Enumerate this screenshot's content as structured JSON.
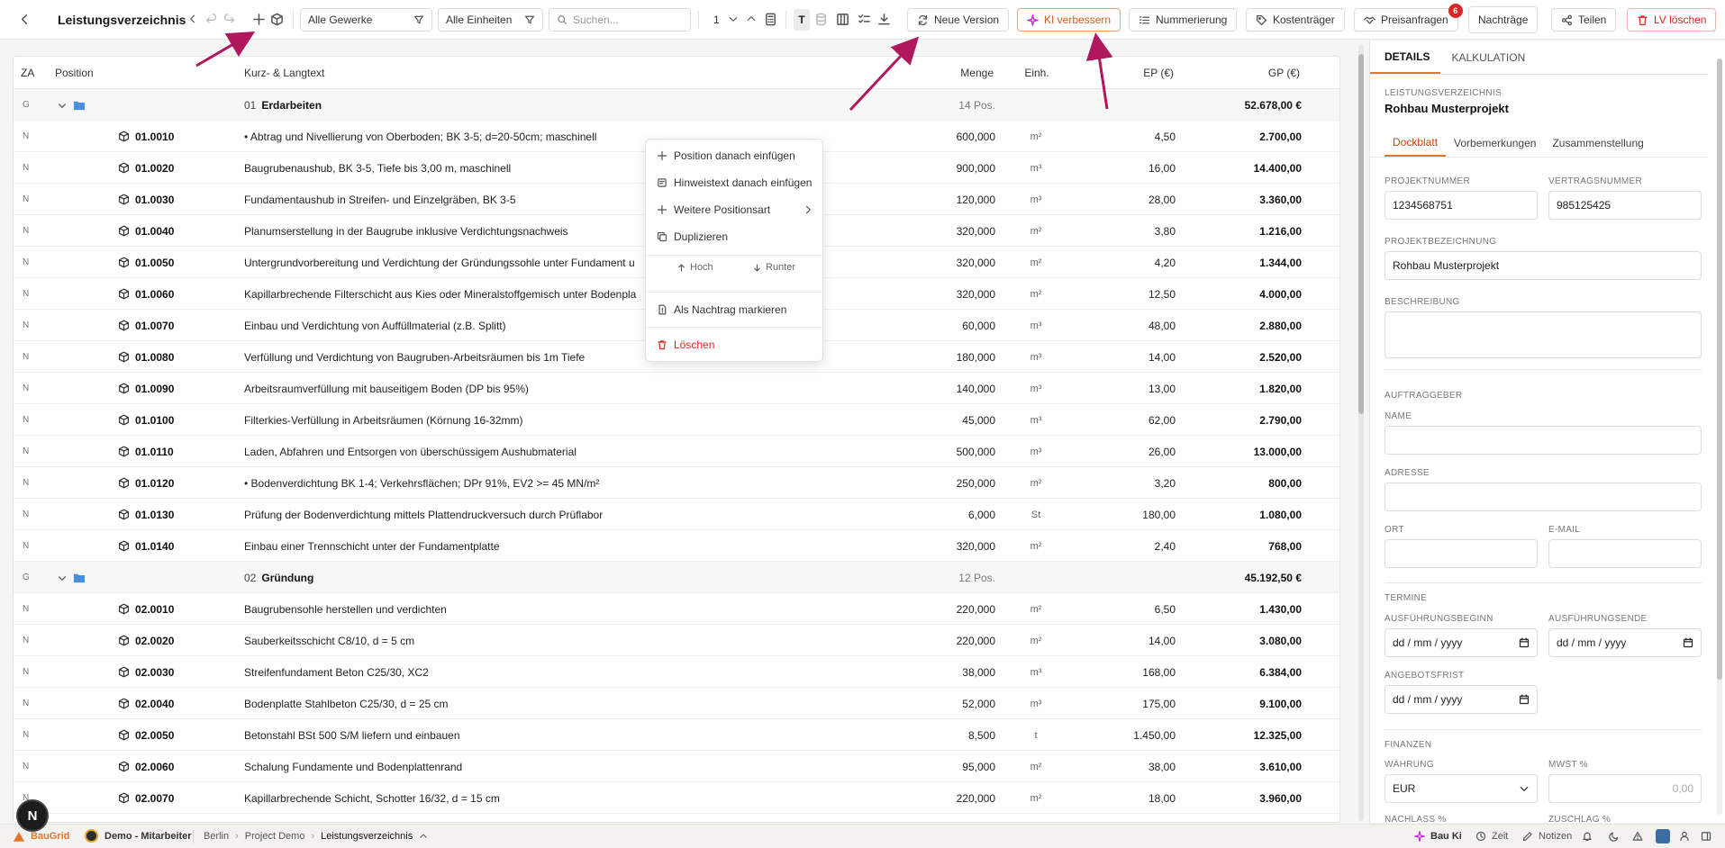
{
  "header": {
    "title": "Leistungsverzeichnis",
    "filter_gewerke": "Alle Gewerke",
    "filter_einheiten": "Alle Einheiten",
    "search_placeholder": "Suchen...",
    "level_value": "1",
    "t_label": "T",
    "buttons": {
      "new_version": "Neue Version",
      "ki": "KI verbessern",
      "numbering": "Nummerierung",
      "cost": "Kostenträger",
      "price": "Preisanfragen",
      "price_badge": "6",
      "supplements": "Nachträge",
      "share": "Teilen",
      "delete": "LV löschen"
    }
  },
  "table": {
    "columns": [
      "ZA",
      "Position",
      "Kurz- & Langtext",
      "Menge",
      "Einh.",
      "EP (€)",
      "GP (€)"
    ],
    "rows": [
      {
        "type": "group",
        "za": "G",
        "number": "01",
        "title": "Erdarbeiten",
        "count": "14 Pos.",
        "gp": "52.678,00 €"
      },
      {
        "type": "item",
        "za": "N",
        "pos": "01.0010",
        "text": "• Abtrag und Nivellierung von Oberboden; BK 3-5; d=20-50cm; maschinell",
        "menge": "600,000",
        "einh": "m²",
        "ep": "4,50",
        "gp": "2.700,00"
      },
      {
        "type": "item",
        "za": "N",
        "pos": "01.0020",
        "text": "Baugrubenaushub, BK 3-5, Tiefe bis 3,00 m, maschinell",
        "menge": "900,000",
        "einh": "m³",
        "ep": "16,00",
        "gp": "14.400,00"
      },
      {
        "type": "item",
        "za": "N",
        "pos": "01.0030",
        "text": "Fundamentaushub in Streifen- und Einzelgräben, BK 3-5",
        "menge": "120,000",
        "einh": "m³",
        "ep": "28,00",
        "gp": "3.360,00"
      },
      {
        "type": "item",
        "za": "N",
        "pos": "01.0040",
        "text": "Planumserstellung in der Baugrube inklusive Verdichtungsnachweis",
        "menge": "320,000",
        "einh": "m²",
        "ep": "3,80",
        "gp": "1.216,00"
      },
      {
        "type": "item",
        "za": "N",
        "pos": "01.0050",
        "text": "Untergrundvorbereitung und Verdichtung der Gründungssohle unter Fundament u",
        "menge": "320,000",
        "einh": "m²",
        "ep": "4,20",
        "gp": "1.344,00"
      },
      {
        "type": "item",
        "za": "N",
        "pos": "01.0060",
        "text": "Kapillarbrechende Filterschicht aus Kies oder Mineralstoffgemisch unter Bodenpla",
        "menge": "320,000",
        "einh": "m²",
        "ep": "12,50",
        "gp": "4.000,00"
      },
      {
        "type": "item",
        "za": "N",
        "pos": "01.0070",
        "text": "Einbau und Verdichtung von Auffüllmaterial (z.B. Splitt)",
        "menge": "60,000",
        "einh": "m³",
        "ep": "48,00",
        "gp": "2.880,00"
      },
      {
        "type": "item",
        "za": "N",
        "pos": "01.0080",
        "text": "Verfüllung und Verdichtung von Baugruben-Arbeitsräumen bis 1m Tiefe",
        "menge": "180,000",
        "einh": "m³",
        "ep": "14,00",
        "gp": "2.520,00"
      },
      {
        "type": "item",
        "za": "N",
        "pos": "01.0090",
        "text": "Arbeitsraumverfüllung mit bauseitigem Boden (DP bis 95%)",
        "menge": "140,000",
        "einh": "m³",
        "ep": "13,00",
        "gp": "1.820,00"
      },
      {
        "type": "item",
        "za": "N",
        "pos": "01.0100",
        "text": "Filterkies-Verfüllung in Arbeitsräumen (Körnung 16-32mm)",
        "menge": "45,000",
        "einh": "m³",
        "ep": "62,00",
        "gp": "2.790,00"
      },
      {
        "type": "item",
        "za": "N",
        "pos": "01.0110",
        "text": "Laden, Abfahren und Entsorgen von überschüssigem Aushubmaterial",
        "menge": "500,000",
        "einh": "m³",
        "ep": "26,00",
        "gp": "13.000,00"
      },
      {
        "type": "item",
        "za": "N",
        "pos": "01.0120",
        "text": "• Bodenverdichtung BK 1-4; Verkehrsflächen; DPr 91%, EV2 >= 45 MN/m²",
        "menge": "250,000",
        "einh": "m²",
        "ep": "3,20",
        "gp": "800,00"
      },
      {
        "type": "item",
        "za": "N",
        "pos": "01.0130",
        "text": "Prüfung der Bodenverdichtung mittels Plattendruckversuch durch Prüflabor",
        "menge": "6,000",
        "einh": "St",
        "ep": "180,00",
        "gp": "1.080,00"
      },
      {
        "type": "item",
        "za": "N",
        "pos": "01.0140",
        "text": "Einbau einer Trennschicht unter der Fundamentplatte",
        "menge": "320,000",
        "einh": "m²",
        "ep": "2,40",
        "gp": "768,00"
      },
      {
        "type": "group",
        "za": "G",
        "number": "02",
        "title": "Gründung",
        "count": "12 Pos.",
        "gp": "45.192,50 €"
      },
      {
        "type": "item",
        "za": "N",
        "pos": "02.0010",
        "text": "Baugrubensohle herstellen und verdichten",
        "menge": "220,000",
        "einh": "m²",
        "ep": "6,50",
        "gp": "1.430,00"
      },
      {
        "type": "item",
        "za": "N",
        "pos": "02.0020",
        "text": "Sauberkeitsschicht C8/10, d = 5 cm",
        "menge": "220,000",
        "einh": "m²",
        "ep": "14,00",
        "gp": "3.080,00"
      },
      {
        "type": "item",
        "za": "N",
        "pos": "02.0030",
        "text": "Streifenfundament Beton C25/30, XC2",
        "menge": "38,000",
        "einh": "m³",
        "ep": "168,00",
        "gp": "6.384,00"
      },
      {
        "type": "item",
        "za": "N",
        "pos": "02.0040",
        "text": "Bodenplatte Stahlbeton C25/30, d = 25 cm",
        "menge": "52,000",
        "einh": "m³",
        "ep": "175,00",
        "gp": "9.100,00"
      },
      {
        "type": "item",
        "za": "N",
        "pos": "02.0050",
        "text": "Betonstahl BSt 500 S/M liefern und einbauen",
        "menge": "8,500",
        "einh": "t",
        "ep": "1.450,00",
        "gp": "12.325,00"
      },
      {
        "type": "item",
        "za": "N",
        "pos": "02.0060",
        "text": "Schalung Fundamente und Bodenplattenrand",
        "menge": "95,000",
        "einh": "m²",
        "ep": "38,00",
        "gp": "3.610,00"
      },
      {
        "type": "item",
        "za": "N",
        "pos": "02.0070",
        "text": "Kapillarbrechende Schicht, Schotter 16/32, d = 15 cm",
        "menge": "220,000",
        "einh": "m²",
        "ep": "18,00",
        "gp": "3.960,00"
      }
    ]
  },
  "context_menu": {
    "insert_position": "Position danach einfügen",
    "insert_note": "Hinweistext danach einfügen",
    "more_types": "Weitere Positionsart",
    "duplicate": "Duplizieren",
    "up": "Hoch",
    "down": "Runter",
    "mark_supplement": "Als Nachtrag markieren",
    "delete": "Löschen"
  },
  "panel": {
    "tabs": [
      "DETAILS",
      "KALKULATION"
    ],
    "section_label": "LEISTUNGSVERZEICHNIS",
    "project_name_heading": "Rohbau Musterprojekt",
    "subtabs": [
      "Dockblatt",
      "Vorbemerkungen",
      "Zusammenstellung"
    ],
    "projektnummer_label": "PROJEKTNUMMER",
    "projektnummer": "1234568751",
    "vertragsnummer_label": "VERTRAGSNUMMER",
    "vertragsnummer": "985125425",
    "projektbezeichnung_label": "PROJEKTBEZEICHNUNG",
    "projektbezeichnung": "Rohbau Musterprojekt",
    "beschreibung_label": "BESCHREIBUNG",
    "auftraggeber_label": "AUFTRAGGEBER",
    "name_label": "NAME",
    "adresse_label": "ADRESSE",
    "ort_label": "ORT",
    "email_label": "E-MAIL",
    "termine_label": "TERMINE",
    "beginn_label": "AUSFÜHRUNGSBEGINN",
    "ende_label": "AUSFÜHRUNGSENDE",
    "angebotsfrist_label": "ANGEBOTSFRIST",
    "date_placeholder": "dd / mm / yyyy",
    "finanzen_label": "FINANZEN",
    "waehrung_label": "WÄHRUNG",
    "waehrung": "EUR",
    "mwst_label": "MWST %",
    "mwst_placeholder": "0,00",
    "nachlass_label": "NACHLASS %",
    "zuschlag_label": "ZUSCHLAG %"
  },
  "statusbar": {
    "brand": "BauGrid",
    "user": "Demo - Mitarbeiter",
    "crumbs": [
      "Berlin",
      "Project Demo",
      "Leistungsverzeichnis"
    ],
    "ki": "Bau Ki",
    "zeit": "Zeit",
    "notizen": "Notizen",
    "avatar_letter": "N"
  },
  "colors": {
    "accent": "#e4762a",
    "danger": "#dc2626",
    "annotation_arrow": "#b0185d",
    "folder": "#4a90e2"
  }
}
